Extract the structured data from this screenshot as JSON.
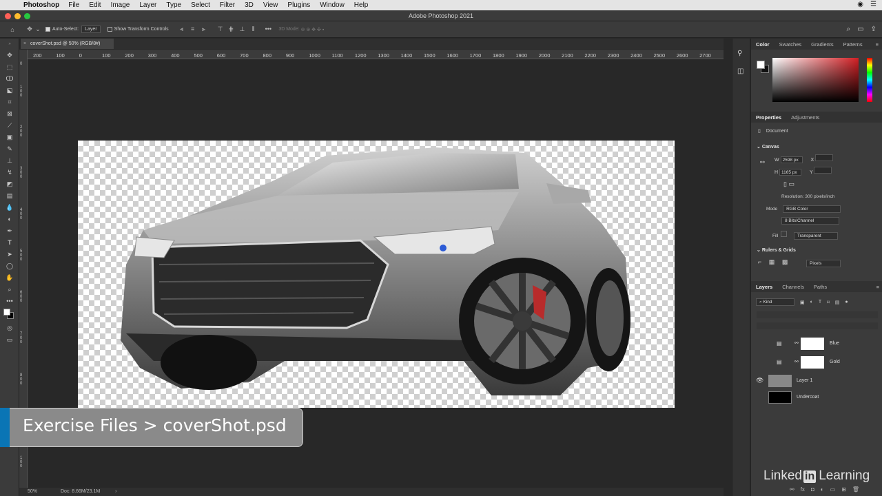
{
  "menubar": {
    "app": "Photoshop",
    "menus": [
      "File",
      "Edit",
      "Image",
      "Layer",
      "Type",
      "Select",
      "Filter",
      "3D",
      "View",
      "Plugins",
      "Window",
      "Help"
    ]
  },
  "window": {
    "title": "Adobe Photoshop 2021"
  },
  "options": {
    "auto_select_label": "Auto-Select:",
    "auto_select_value": "Layer",
    "transform_label": "Show Transform Controls",
    "mode_3d": "3D Mode:"
  },
  "tab": {
    "label": "coverShot.psd @ 50% (RGB/8#)"
  },
  "ruler": {
    "top": [
      "200",
      "100",
      "0",
      "100",
      "200",
      "300",
      "400",
      "500",
      "600",
      "700",
      "800",
      "900",
      "1000",
      "1100",
      "1200",
      "1300",
      "1400",
      "1500",
      "1600",
      "1700",
      "1800",
      "1900",
      "2000",
      "2100",
      "2200",
      "2300",
      "2400",
      "2500",
      "2600",
      "2700"
    ]
  },
  "status": {
    "zoom": "50%",
    "doc": "Doc: 8.66M/23.1M"
  },
  "color_panel": {
    "tabs": [
      "Color",
      "Swatches",
      "Gradients",
      "Patterns"
    ],
    "active": "Color",
    "accent": "#c0262c"
  },
  "properties": {
    "tabs": [
      "Properties",
      "Adjustments"
    ],
    "type": "Document",
    "canvas_label": "Canvas",
    "w_label": "W",
    "w": "2598 px",
    "h_label": "H",
    "h": "1165 px",
    "x_label": "X",
    "y_label": "Y",
    "resolution": "Resolution: 300 pixels/inch",
    "mode_label": "Mode",
    "mode": "RGB Color",
    "bits": "8 Bits/Channel",
    "fill_label": "Fill",
    "fill": "Transparent",
    "rulers_label": "Rulers & Grids",
    "units": "Pixels"
  },
  "layers": {
    "tabs": [
      "Layers",
      "Channels",
      "Paths"
    ],
    "kind": "Kind",
    "items": [
      {
        "name": "Blue"
      },
      {
        "name": "Gold"
      },
      {
        "name": "Layer 1"
      },
      {
        "name": "Undercoat"
      }
    ]
  },
  "overlay": {
    "text": "Exercise Files > coverShot.psd"
  },
  "watermark": {
    "word1": "Linked",
    "box": "in",
    "word2": "Learning"
  }
}
